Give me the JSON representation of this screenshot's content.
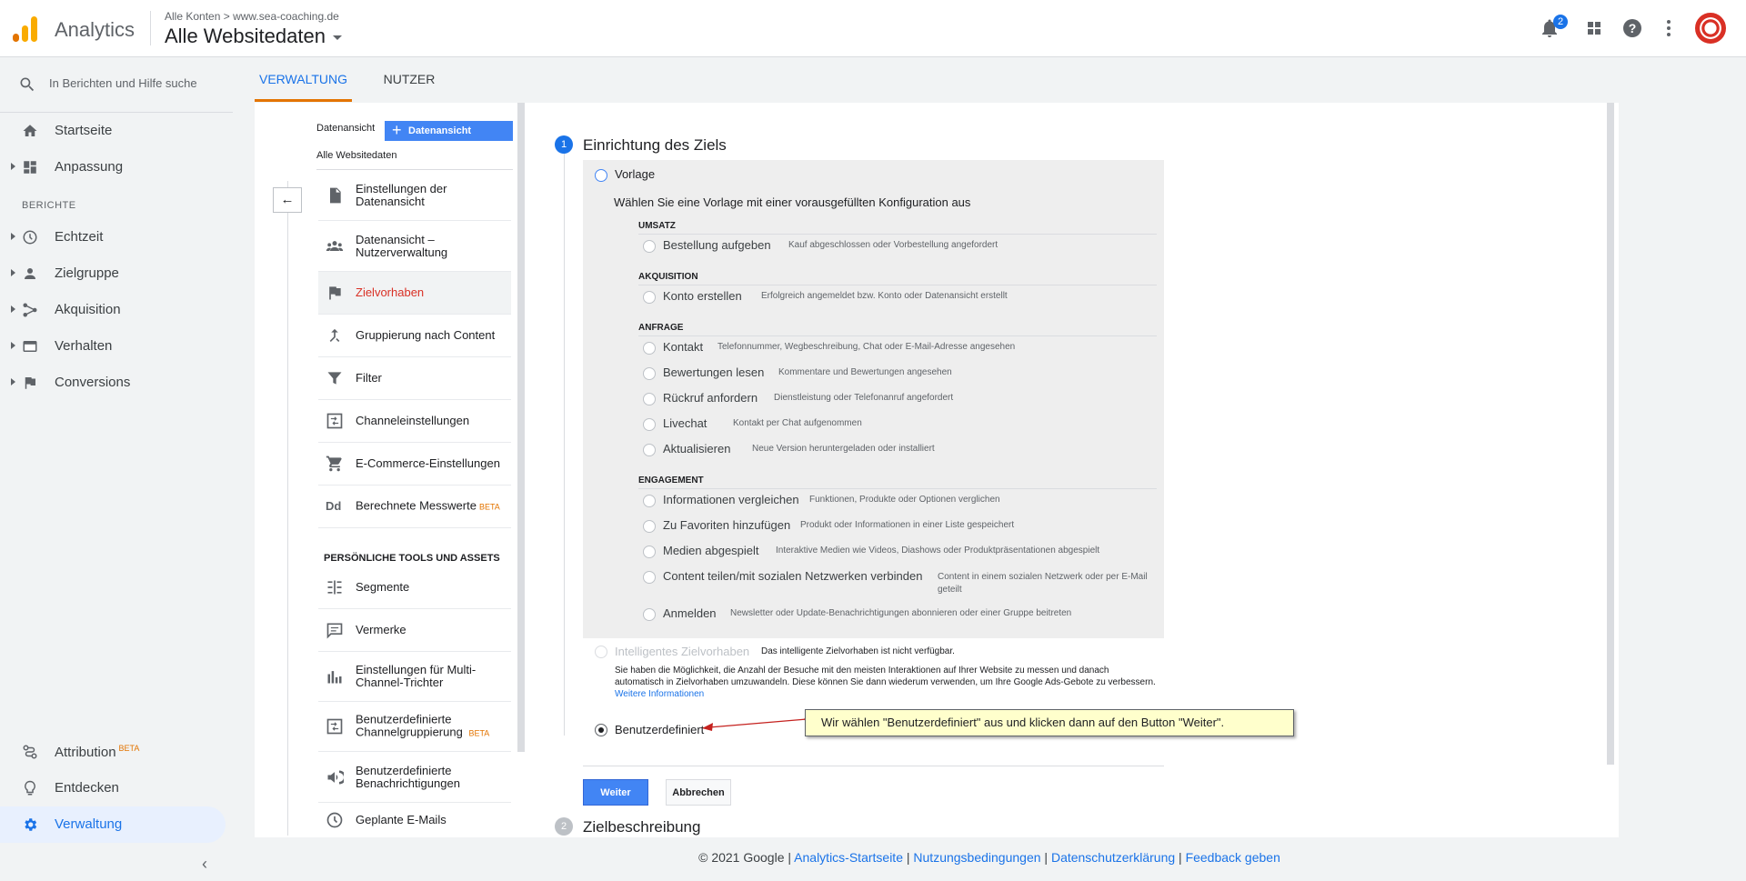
{
  "header": {
    "app_name": "Analytics",
    "breadcrumb_root": "Alle Konten",
    "breadcrumb_sep": ">",
    "breadcrumb_account": "www.sea-coaching.de",
    "property": "Alle Websitedaten",
    "notification_count": "2",
    "colors": {
      "brand_orange": "#f9ab00",
      "brand_dark_orange": "#e37400",
      "accent_blue": "#1a73e8"
    }
  },
  "nav": {
    "search_placeholder": "In Berichten und Hilfe suche",
    "items_top": [
      {
        "label": "Startseite",
        "icon": "home-icon"
      },
      {
        "label": "Anpassung",
        "icon": "dashboard-icon"
      }
    ],
    "reports_label": "BERICHTE",
    "items_reports": [
      {
        "label": "Echtzeit",
        "icon": "clock-icon"
      },
      {
        "label": "Zielgruppe",
        "icon": "person-icon"
      },
      {
        "label": "Akquisition",
        "icon": "acquisition-icon"
      },
      {
        "label": "Verhalten",
        "icon": "behavior-icon"
      },
      {
        "label": "Conversions",
        "icon": "flag-icon"
      }
    ],
    "items_bottom": [
      {
        "label": "Attribution",
        "badge": "BETA",
        "icon": "attribution-icon"
      },
      {
        "label": "Entdecken",
        "icon": "lightbulb-icon"
      },
      {
        "label": "Verwaltung",
        "icon": "gear-icon"
      }
    ]
  },
  "tabs": {
    "admin": "VERWALTUNG",
    "user": "NUTZER"
  },
  "view_column": {
    "label": "Datenansicht",
    "create_button": "Datenansicht erstellen",
    "view_name": "Alle Websitedaten",
    "menu": [
      {
        "label": "Einstellungen der Datenansicht",
        "icon": "document-icon"
      },
      {
        "label": "Datenansicht – Nutzerverwaltung",
        "icon": "people-icon"
      },
      {
        "label": "Zielvorhaben",
        "icon": "flag-icon",
        "selected": true
      },
      {
        "label": "Gruppierung nach Content",
        "icon": "merge-icon"
      },
      {
        "label": "Filter",
        "icon": "filter-icon"
      },
      {
        "label": "Channeleinstellungen",
        "icon": "channel-icon"
      },
      {
        "label": "E-Commerce-Einstellungen",
        "icon": "cart-icon"
      },
      {
        "label": "Berechnete Messwerte",
        "badge": "BETA",
        "icon": "dd-icon"
      }
    ],
    "tools_label": "PERSÖNLICHE TOOLS UND ASSETS",
    "tools": [
      {
        "label": "Segmente",
        "icon": "segments-icon"
      },
      {
        "label": "Vermerke",
        "icon": "comment-icon"
      },
      {
        "label": "Einstellungen für Multi-Channel-Trichter",
        "icon": "bar-chart-icon"
      },
      {
        "label": "Benutzerdefinierte Channelgruppierung",
        "badge": "BETA",
        "icon": "channel-icon"
      },
      {
        "label": "Benutzerdefinierte Benachrichtigungen",
        "icon": "megaphone-icon"
      },
      {
        "label": "Geplante E-Mails",
        "icon": "clock-icon"
      }
    ]
  },
  "goal_setup": {
    "step1_number": "1",
    "step1_title": "Einrichtung des Ziels",
    "template_label": "Vorlage",
    "template_desc": "Wählen Sie eine Vorlage mit einer vorausgefüllten Konfiguration aus",
    "categories": [
      {
        "name": "UMSATZ",
        "options": [
          {
            "label": "Bestellung aufgeben",
            "desc": "Kauf abgeschlossen oder Vorbestellung angefordert"
          }
        ]
      },
      {
        "name": "AKQUISITION",
        "options": [
          {
            "label": "Konto erstellen",
            "desc": "Erfolgreich angemeldet bzw. Konto oder Datenansicht erstellt"
          }
        ]
      },
      {
        "name": "ANFRAGE",
        "options": [
          {
            "label": "Kontakt",
            "desc": "Telefonnummer, Wegbeschreibung, Chat oder E-Mail-Adresse angesehen"
          },
          {
            "label": "Bewertungen lesen",
            "desc": "Kommentare und Bewertungen angesehen"
          },
          {
            "label": "Rückruf anfordern",
            "desc": "Dienstleistung oder Telefonanruf angefordert"
          },
          {
            "label": "Livechat",
            "desc": "Kontakt per Chat aufgenommen"
          },
          {
            "label": "Aktualisieren",
            "desc": "Neue Version heruntergeladen oder installiert"
          }
        ]
      },
      {
        "name": "ENGAGEMENT",
        "options": [
          {
            "label": "Informationen vergleichen",
            "desc": "Funktionen, Produkte oder Optionen verglichen"
          },
          {
            "label": "Zu Favoriten hinzufügen",
            "desc": "Produkt oder Informationen in einer Liste gespeichert"
          },
          {
            "label": "Medien abgespielt",
            "desc": "Interaktive Medien wie Videos, Diashows oder Produktpräsentationen abgespielt"
          },
          {
            "label": "Content teilen/mit sozialen Netzwerken verbinden",
            "desc": "Content in einem sozialen Netzwerk oder per E-Mail geteilt"
          },
          {
            "label": "Anmelden",
            "desc": "Newsletter oder Update-Benachrichtigungen abonnieren oder einer Gruppe beitreten"
          }
        ]
      }
    ],
    "smart_goal_label": "Intelligentes Zielvorhaben",
    "smart_goal_note": "Das intelligente Zielvorhaben ist nicht verfügbar.",
    "smart_goal_desc": "Sie haben die Möglichkeit, die Anzahl der Besuche mit den meisten Interaktionen auf Ihrer Website zu messen und danach automatisch in Zielvorhaben umzuwandeln. Diese können Sie dann wiederum verwenden, um Ihre Google Ads-Gebote zu verbessern.",
    "smart_goal_link": "Weitere Informationen",
    "custom_label": "Benutzerdefiniert",
    "callout": "Wir wählen \"Benutzerdefiniert\" aus und klicken dann auf den Button \"Weiter\".",
    "continue_button": "Weiter",
    "cancel_button": "Abbrechen",
    "step2_number": "2",
    "step2_title": "Zielbeschreibung"
  },
  "footer": {
    "copyright": "© 2021 Google",
    "sep": "|",
    "links": [
      "Analytics-Startseite",
      "Nutzungsbedingungen",
      "Datenschutzerklärung",
      "Feedback geben"
    ]
  }
}
